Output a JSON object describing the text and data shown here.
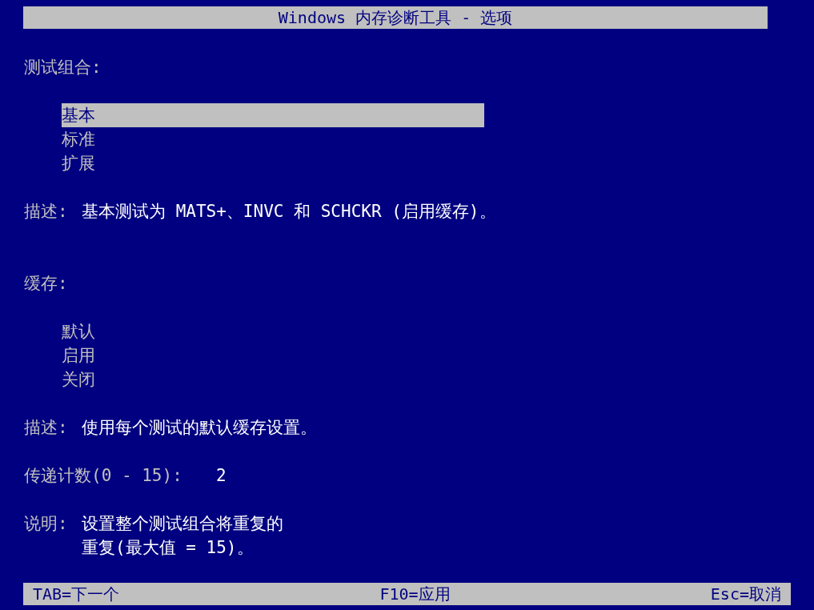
{
  "title": "Windows 内存诊断工具 - 选项",
  "test_mix": {
    "label": "测试组合:",
    "options": [
      {
        "label": "基本",
        "selected": true
      },
      {
        "label": "标准",
        "selected": false
      },
      {
        "label": "扩展",
        "selected": false
      }
    ],
    "description_label": "描述:",
    "description": "基本测试为 MATS+、INVC 和 SCHCKR (启用缓存)。"
  },
  "cache": {
    "label": "缓存:",
    "options": [
      {
        "label": "默认"
      },
      {
        "label": "启用"
      },
      {
        "label": "关闭"
      }
    ],
    "description_label": "描述:",
    "description": "使用每个测试的默认缓存设置。"
  },
  "pass_count": {
    "label": "传递计数(0 - 15):",
    "value": "2"
  },
  "note": {
    "label": "说明:",
    "lines": [
      "设置整个测试组合将重复的",
      "重复(最大值 = 15)。"
    ]
  },
  "footer": [
    "TAB=下一个",
    "F10=应用",
    "Esc=取消"
  ]
}
